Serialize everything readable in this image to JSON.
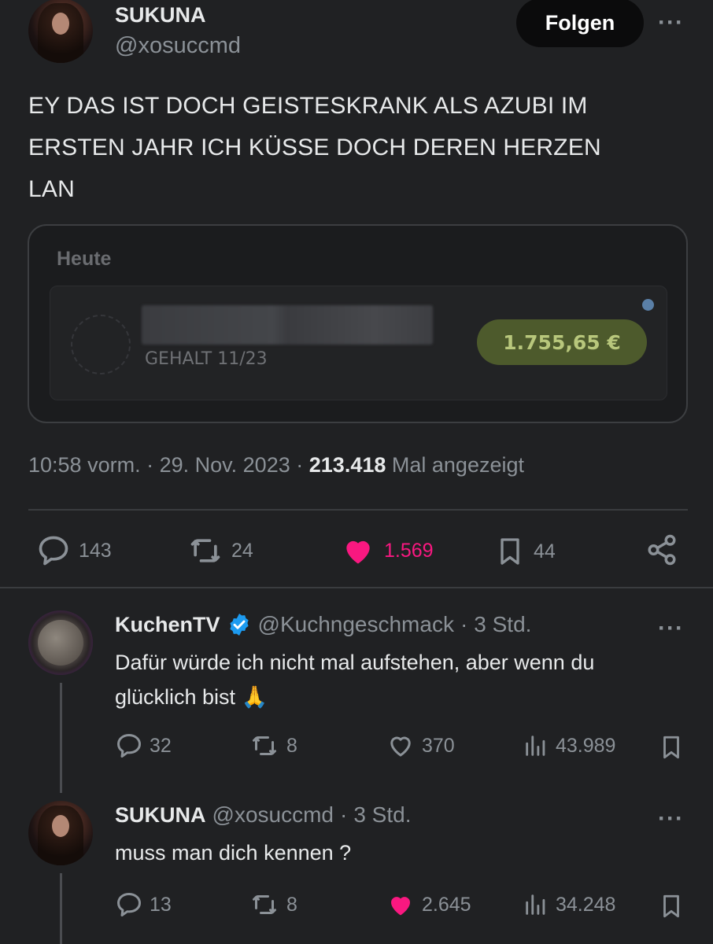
{
  "tweet": {
    "author": {
      "name": "SUKUNA",
      "handle": "@xosuccmd"
    },
    "follow_label": "Folgen",
    "more": "···",
    "text_lines": [
      "EY DAS IST DOCH GEISTESKRANK ALS AZUBI IM",
      "ERSTEN JAHR ICH KÜSSE DOCH DEREN HERZEN",
      "LAN"
    ],
    "card": {
      "heading": "Heute",
      "label": "GEHALT 11/23",
      "amount": "1.755,65 €"
    },
    "meta": {
      "time": "10:58 vorm.",
      "sep1": "·",
      "date": "29. Nov. 2023",
      "sep2": "·",
      "views": "213.418",
      "views_label": "Mal angezeigt"
    },
    "actions": {
      "replies": "143",
      "retweets": "24",
      "likes": "1.569",
      "bookmarks": "44"
    },
    "icons": [
      "reply-icon",
      "retweet-icon",
      "heart-filled-icon",
      "bookmark-icon",
      "share-icon"
    ],
    "colors": {
      "like": "#f91880",
      "verified": "#1d9bf0",
      "muted": "#8b9197"
    }
  },
  "replies": [
    {
      "name": "KuchenTV",
      "verified": true,
      "handle": "@Kuchngeschmack",
      "sep": "·",
      "time": "3 Std.",
      "more": "···",
      "text_lines": [
        "Dafür würde ich nicht mal aufstehen, aber wenn du",
        "glücklich bist 🙏"
      ],
      "actions": {
        "replies": "32",
        "retweets": "8",
        "likes": "370",
        "views": "43.989"
      },
      "liked": false
    },
    {
      "name": "SUKUNA",
      "verified": false,
      "handle": "@xosuccmd",
      "sep": "·",
      "time": "3 Std.",
      "more": "···",
      "text_lines": [
        "muss man dich kennen ?"
      ],
      "actions": {
        "replies": "13",
        "retweets": "8",
        "likes": "2.645",
        "views": "34.248"
      },
      "liked": true
    }
  ]
}
